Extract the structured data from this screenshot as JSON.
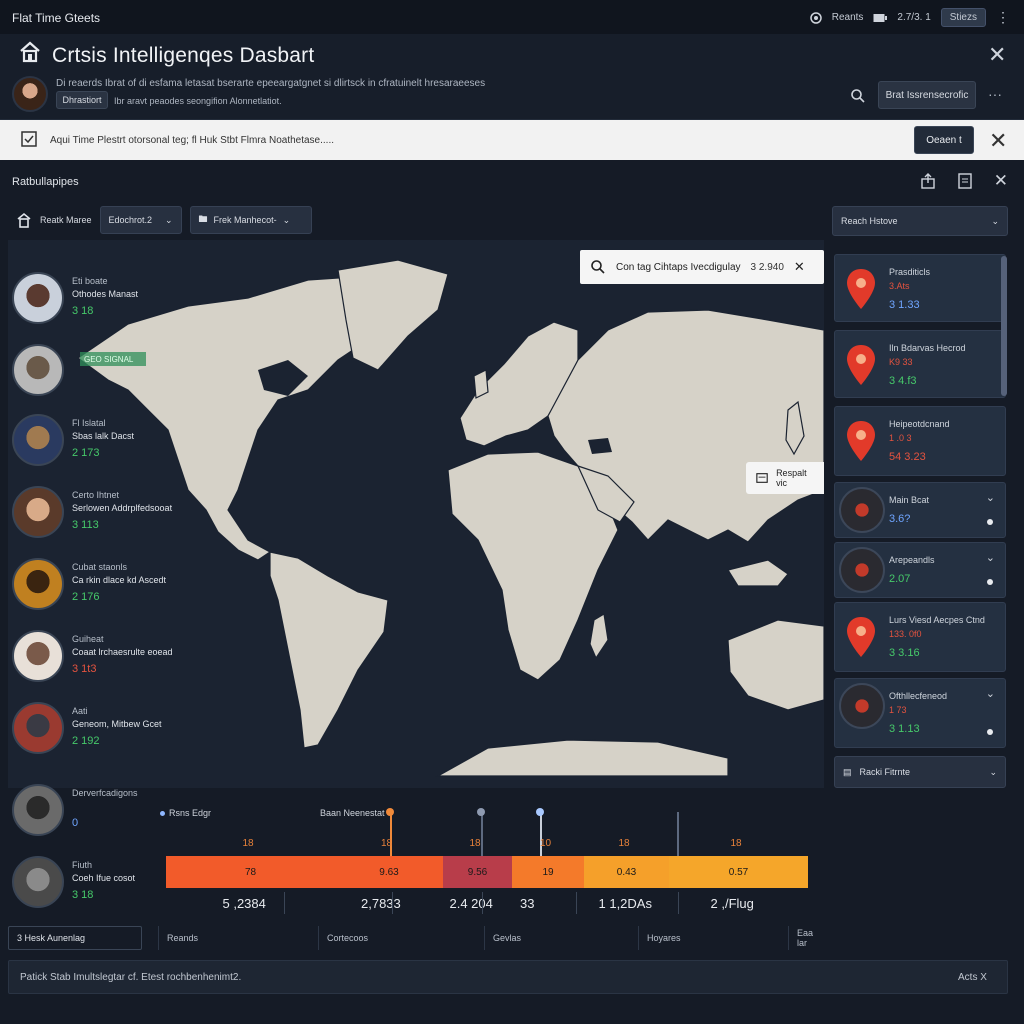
{
  "app": {
    "title": "Flat Time Gteets"
  },
  "topbar": {
    "reports_label": "Reants",
    "version": "2.7/3. 1",
    "badge": "Stiezs"
  },
  "header": {
    "title": "Crtsis Intelligenqes Dasbart",
    "description": "Di reaerds Ibrat of di esfama letasat bserarte epeeargatgnet si dlirtsck in cfratuinelt hresaraeeses.",
    "badge": "Dhrastiort",
    "subline": "Ibr aravt peaodes seongifion Alonnetlatiot.",
    "button": "Brat Issrensecrofic"
  },
  "alert": {
    "text": "Aqui Time  Plestrt otorsonal teg; fl Huk Stbt Flmra Noathetase.....",
    "button": "Oeaen t"
  },
  "panel": {
    "title": "Ratbullapipes",
    "filter1_label": "Reatk Maree",
    "filter2_label": "Edochrot.2",
    "filter3_label": "Frek Manhecot-",
    "right_dropdown": "Reach Hstove"
  },
  "locations": [
    {
      "t1": "Eti boate",
      "t2": "Othodes Manast",
      "val": "3 18",
      "color": "g"
    },
    {
      "t1": "",
      "t2": "",
      "val": "",
      "color": "g"
    },
    {
      "t1": "Fl Islatal",
      "t2": "Sbas lalk Dacst",
      "val": "2 173",
      "color": "g"
    },
    {
      "t1": "Certo Ihtnet",
      "t2": "Serlowen Addrplfedsooat",
      "val": "3 113",
      "color": "g"
    },
    {
      "t1": "Cubat staonls",
      "t2": "Ca rkin dlace kd Ascedt",
      "val": "2 176",
      "color": "g"
    },
    {
      "t1": "Guiheat",
      "t2": "Coaat lrchaesrulte eoead",
      "val": "3 1t3",
      "color": "r"
    },
    {
      "t1": "Aati",
      "t2": "Geneom, Mitbew Gcet",
      "val": "2 192",
      "color": "g"
    },
    {
      "t1": "Derverfcadigons",
      "t2": "",
      "val": "0",
      "color": "b"
    },
    {
      "t1": "Fiuth",
      "t2": "Coeh Ifue cosot",
      "val": "3 18",
      "color": "g"
    }
  ],
  "map": {
    "popup_text": "Con tag Cihtaps Ivecdigulay",
    "popup_value": "3 2.940",
    "reset_label": "Respalt vic",
    "marker_label": "GEO SIGNAL"
  },
  "cards": [
    {
      "c1": "Prasditicls",
      "c2": "3.Ats",
      "c3": "3 1.33",
      "c2col": "r",
      "c3col": "b"
    },
    {
      "c1": "Iln Bdarvas Hecrod",
      "c2": "K9 33",
      "c3": "3 4.f3",
      "c2col": "r",
      "c3col": "g"
    },
    {
      "c1": "Heipeotdcnand",
      "c2": "1 .0 3",
      "c3": "54 3.23",
      "c2col": "r",
      "c3col": "r"
    },
    {
      "c1": "Main Bcat",
      "c2": "",
      "c3": "3.6?",
      "c2col": "r",
      "c3col": "b"
    },
    {
      "c1": "Arepeandls",
      "c2": "",
      "c3": "2.07",
      "c2col": "r",
      "c3col": "g"
    },
    {
      "c1": "Lurs Viesd Aecpes Ctnd",
      "c2": "133. 0f0",
      "c3": "3 3.16",
      "c2col": "r",
      "c3col": "g"
    },
    {
      "c1": "Ofthllecfeneod",
      "c2": "1 73",
      "c3": "3 1.13",
      "c2col": "r",
      "c3col": "g"
    }
  ],
  "bottom_card": {
    "label": "Racki Fitrnte"
  },
  "timeline": {
    "label_left": "Rsns Edgr",
    "label_mid": "Baan Neenestat",
    "top_labels": [
      "18",
      "18",
      "18",
      "10",
      "18",
      "18"
    ],
    "segments": [
      {
        "label": "78",
        "color": "#f25b2a",
        "weight": 1.1
      },
      {
        "label": "9.63",
        "color": "#f25b2a",
        "weight": 0.7
      },
      {
        "label": "9.56",
        "color": "#b83d4a",
        "weight": 0.45
      },
      {
        "label": "19",
        "color": "#f47a2a",
        "weight": 0.47
      },
      {
        "label": "0.43",
        "color": "#f5a02a",
        "weight": 0.55
      },
      {
        "label": "0.57",
        "color": "#f5a62a",
        "weight": 0.9
      }
    ],
    "bottom_values": [
      "5 ,2384",
      "2,7833",
      "2.4 204",
      "33",
      "1 1,2DAs",
      "2 ,/Flug"
    ]
  },
  "legend": {
    "items": [
      "3 Hesk Aunenlag",
      "Reands",
      "Cortecoos",
      "Gevlas",
      "Hoyares",
      "Eaa lar"
    ]
  },
  "status": {
    "text": "Patick Stab Imultslegtar cf. Etest rochbenhenimt2.",
    "right": "Acts X"
  }
}
